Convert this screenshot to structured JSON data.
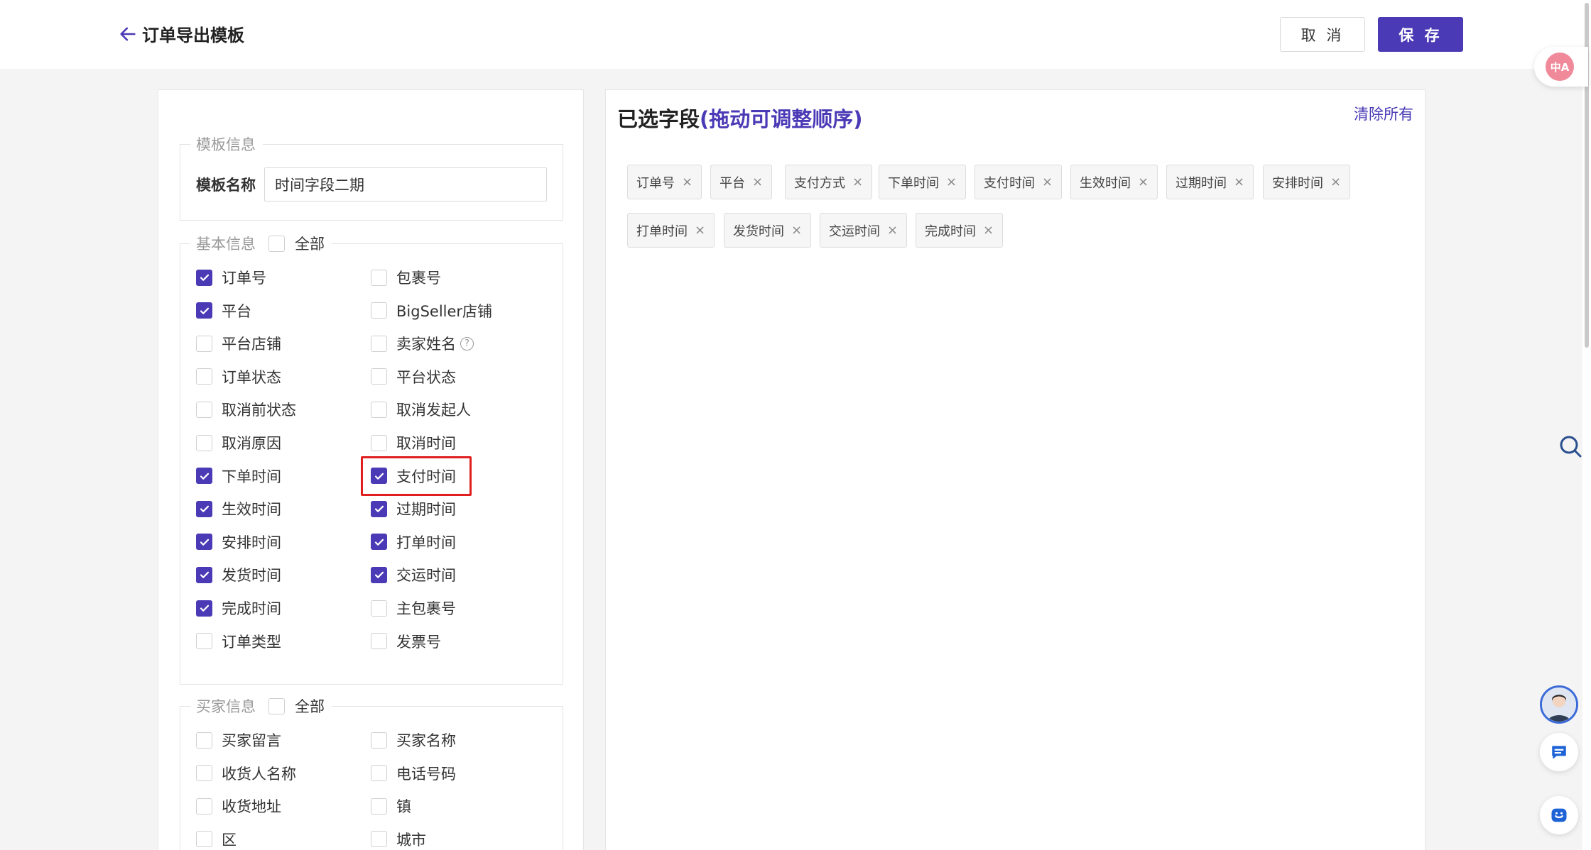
{
  "header": {
    "title": "订单导出模板",
    "cancel_label": "取 消",
    "save_label": "保 存"
  },
  "template_info": {
    "legend": "模板信息",
    "name_label": "模板名称",
    "name_value": "时间字段二期"
  },
  "basic_info": {
    "legend": "基本信息",
    "all_label": "全部",
    "all_checked": false,
    "fields": [
      {
        "label": "订单号",
        "checked": true
      },
      {
        "label": "包裹号",
        "checked": false
      },
      {
        "label": "平台",
        "checked": true
      },
      {
        "label": "BigSeller店铺",
        "checked": false
      },
      {
        "label": "平台店铺",
        "checked": false
      },
      {
        "label": "卖家姓名",
        "checked": false,
        "help": true
      },
      {
        "label": "订单状态",
        "checked": false
      },
      {
        "label": "平台状态",
        "checked": false
      },
      {
        "label": "取消前状态",
        "checked": false
      },
      {
        "label": "取消发起人",
        "checked": false
      },
      {
        "label": "取消原因",
        "checked": false
      },
      {
        "label": "取消时间",
        "checked": false
      },
      {
        "label": "下单时间",
        "checked": true
      },
      {
        "label": "支付时间",
        "checked": true,
        "highlight": true
      },
      {
        "label": "生效时间",
        "checked": true
      },
      {
        "label": "过期时间",
        "checked": true
      },
      {
        "label": "安排时间",
        "checked": true
      },
      {
        "label": "打单时间",
        "checked": true
      },
      {
        "label": "发货时间",
        "checked": true
      },
      {
        "label": "交运时间",
        "checked": true
      },
      {
        "label": "完成时间",
        "checked": true
      },
      {
        "label": "主包裹号",
        "checked": false
      },
      {
        "label": "订单类型",
        "checked": false
      },
      {
        "label": "发票号",
        "checked": false
      }
    ]
  },
  "buyer_info": {
    "legend": "买家信息",
    "all_label": "全部",
    "all_checked": false,
    "fields": [
      {
        "label": "买家留言",
        "checked": false
      },
      {
        "label": "买家名称",
        "checked": false
      },
      {
        "label": "收货人名称",
        "checked": false
      },
      {
        "label": "电话号码",
        "checked": false
      },
      {
        "label": "收货地址",
        "checked": false
      },
      {
        "label": "镇",
        "checked": false
      },
      {
        "label": "区",
        "checked": false
      },
      {
        "label": "城市",
        "checked": false
      }
    ]
  },
  "selected": {
    "title": "已选字段",
    "hint": "(拖动可调整顺序)",
    "clear_label": "清除所有",
    "tags": [
      "订单号",
      "平台",
      "支付方式",
      "下单时间",
      "支付时间",
      "生效时间",
      "过期时间",
      "安排时间",
      "打单时间",
      "发货时间",
      "交运时间",
      "完成时间"
    ]
  },
  "floating": {
    "translate_label": "中A"
  },
  "colors": {
    "accent": "#4a3ab6",
    "highlight": "#e02020"
  }
}
